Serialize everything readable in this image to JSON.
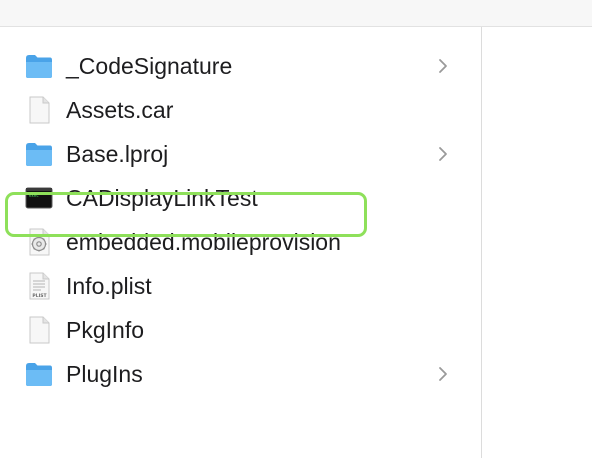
{
  "accent": {
    "folder_color": "#5fb3ee",
    "highlight_color": "#8ee05a"
  },
  "files": [
    {
      "name": "_CodeSignature",
      "icon": "folder-icon",
      "has_chevron": true
    },
    {
      "name": "Assets.car",
      "icon": "document-icon",
      "has_chevron": false
    },
    {
      "name": "Base.lproj",
      "icon": "folder-icon",
      "has_chevron": true
    },
    {
      "name": "CADisplayLinkTest",
      "icon": "executable-icon",
      "has_chevron": false,
      "highlighted": true
    },
    {
      "name": "embedded.mobileprovision",
      "icon": "provision-icon",
      "has_chevron": false
    },
    {
      "name": "Info.plist",
      "icon": "plist-icon",
      "has_chevron": false
    },
    {
      "name": "PkgInfo",
      "icon": "document-icon",
      "has_chevron": false
    },
    {
      "name": "PlugIns",
      "icon": "folder-icon",
      "has_chevron": true
    }
  ],
  "icon_labels": {
    "plist": "PLIST",
    "exec": "exec"
  }
}
